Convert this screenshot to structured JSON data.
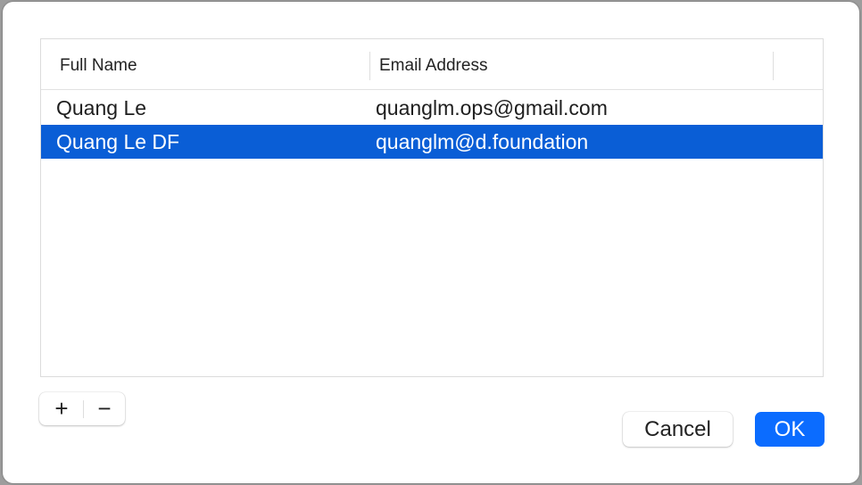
{
  "table": {
    "columns": [
      "Full Name",
      "Email Address"
    ],
    "rows": [
      {
        "name": "Quang Le",
        "email": "quanglm.ops@gmail.com",
        "selected": false
      },
      {
        "name": "Quang Le DF",
        "email": "quanglm@d.foundation",
        "selected": true
      }
    ]
  },
  "controls": {
    "add": "+",
    "remove": "−"
  },
  "buttons": {
    "cancel": "Cancel",
    "ok": "OK"
  },
  "colors": {
    "selection": "#0a5ed6",
    "accent": "#0b6cff"
  }
}
